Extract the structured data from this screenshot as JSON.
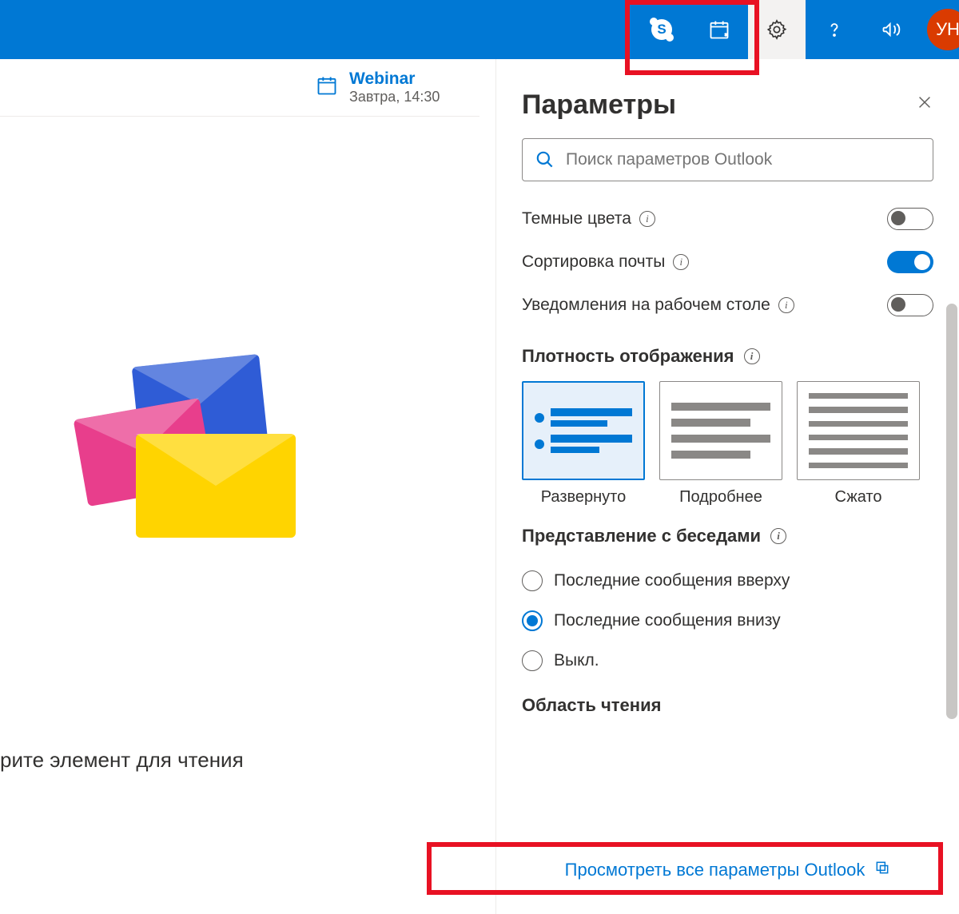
{
  "topbar": {
    "avatar_initials": "УН"
  },
  "event": {
    "title": "Webinar",
    "time": "Завтра, 14:30"
  },
  "main": {
    "hint": "рите элемент для чтения"
  },
  "panel": {
    "title": "Параметры",
    "search_placeholder": "Поиск параметров Outlook",
    "settings": {
      "dark": {
        "label": "Темные цвета",
        "on": false
      },
      "focused": {
        "label": "Сортировка почты",
        "on": true
      },
      "desktop_notif": {
        "label": "Уведомления на рабочем столе",
        "on": false
      }
    },
    "density": {
      "title": "Плотность отображения",
      "options": [
        "Развернуто",
        "Подробнее",
        "Сжато"
      ],
      "selected": 0
    },
    "conversation": {
      "title": "Представление с беседами",
      "options": [
        "Последние сообщения вверху",
        "Последние сообщения внизу",
        "Выкл."
      ],
      "selected": 1
    },
    "reading_area_title": "Область чтения",
    "view_all": "Просмотреть все параметры Outlook"
  }
}
